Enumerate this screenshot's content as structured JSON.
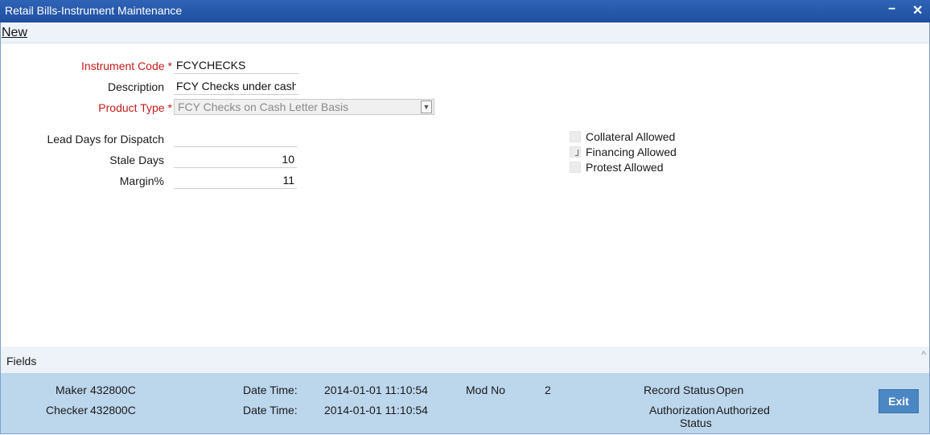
{
  "window": {
    "title": "Retail Bills-Instrument Maintenance",
    "minimize": "−",
    "close": "✕"
  },
  "menu": {
    "new": "New"
  },
  "form": {
    "instrument_code": {
      "label": "Instrument Code",
      "value": "FCYCHECKS"
    },
    "description": {
      "label": "Description",
      "value": "FCY Checks under cash l"
    },
    "product_type": {
      "label": "Product Type",
      "value": "FCY Checks on Cash Letter Basis"
    },
    "lead_days": {
      "label": "Lead Days for Dispatch",
      "value": ""
    },
    "stale_days": {
      "label": "Stale Days",
      "value": "10"
    },
    "margin": {
      "label": "Margin%",
      "value": "11"
    },
    "required_mark": "*"
  },
  "checkboxes": {
    "collateral": {
      "label": "Collateral Allowed",
      "checked": false
    },
    "financing": {
      "label": "Financing Allowed",
      "checked": true
    },
    "protest": {
      "label": "Protest Allowed",
      "checked": false
    }
  },
  "fields_bar": {
    "label": "Fields",
    "caret": "^"
  },
  "audit": {
    "maker_label": "Maker",
    "maker_value": "432800C",
    "checker_label": "Checker",
    "checker_value": "432800C",
    "datetime_label": "Date Time:",
    "maker_datetime": "2014-01-01 11:10:54",
    "checker_datetime": "2014-01-01 11:10:54",
    "mod_no_label": "Mod No",
    "mod_no_value": "2",
    "record_status_label": "Record Status",
    "record_status_value": "Open",
    "auth_status_label_1": "Authorization",
    "auth_status_label_2": "Status",
    "auth_status_value": "Authorized"
  },
  "buttons": {
    "exit": "Exit"
  }
}
